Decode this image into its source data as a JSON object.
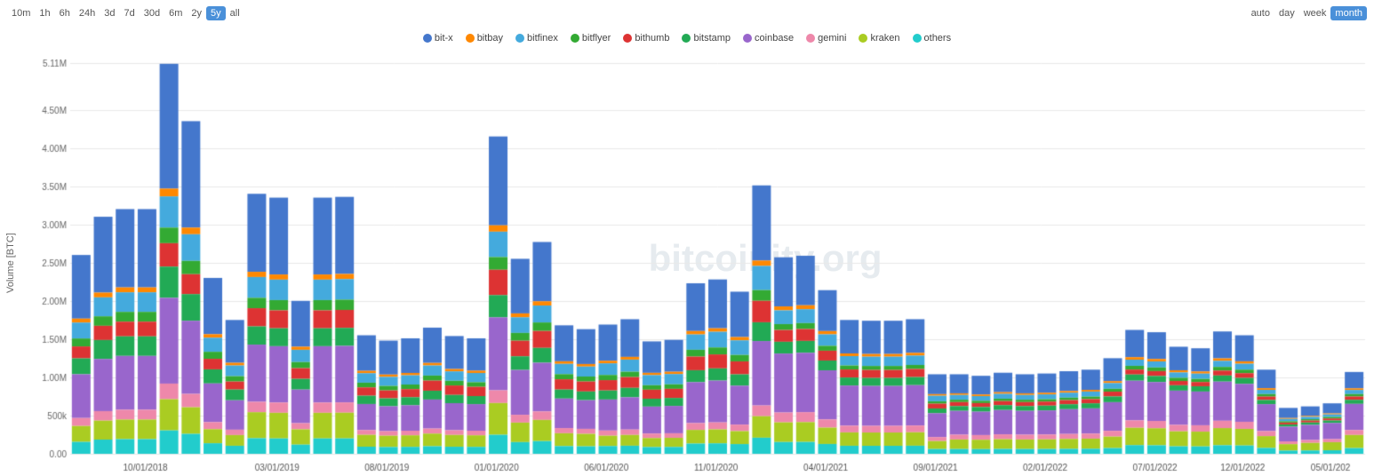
{
  "timeButtons": [
    "10m",
    "1h",
    "6h",
    "24h",
    "3d",
    "7d",
    "30d",
    "6m",
    "2y",
    "5y",
    "all"
  ],
  "activeButton": "5y",
  "periodButtons": [
    "auto",
    "day",
    "week",
    "month"
  ],
  "activePeriod": "month",
  "legend": [
    {
      "key": "bit-x",
      "color": "#4477cc"
    },
    {
      "key": "bitbay",
      "color": "#ff8800"
    },
    {
      "key": "bitfinex",
      "color": "#44aadd"
    },
    {
      "key": "bitflyer",
      "color": "#33aa33"
    },
    {
      "key": "bithumb",
      "color": "#dd3333"
    },
    {
      "key": "bitstamp",
      "color": "#22aa55"
    },
    {
      "key": "coinbase",
      "color": "#9966cc"
    },
    {
      "key": "gemini",
      "color": "#ee88aa"
    },
    {
      "key": "kraken",
      "color": "#aacc22"
    },
    {
      "key": "others",
      "color": "#22cccc"
    }
  ],
  "yAxisLabel": "Volume [BTC]",
  "watermark": "bitcoinity.org",
  "yLabels": [
    "5.11M",
    "4.50M",
    "4.00M",
    "3.50M",
    "3.00M",
    "2.50M",
    "2.00M",
    "1.50M",
    "1.00M",
    "500k",
    "0.00"
  ],
  "xLabels": [
    "10/01/2018",
    "03/01/2019",
    "08/01/2019",
    "01/01/2020",
    "06/01/2020",
    "11/01/2020",
    "04/01/2021",
    "09/01/2021",
    "02/01/2022",
    "07/01/2022",
    "12/01/2022",
    "05/01/202"
  ]
}
